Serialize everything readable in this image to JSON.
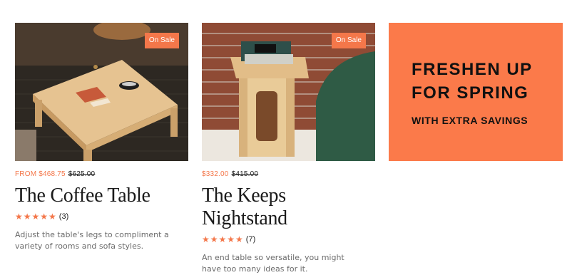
{
  "products": [
    {
      "badge": "On Sale",
      "price_sale": "FROM $468.75",
      "price_original": "$625.00",
      "title": "The Coffee Table",
      "stars": "★★★★★",
      "review_count": "(3)",
      "description": "Adjust the table's legs to compliment a variety of rooms and sofa styles."
    },
    {
      "badge": "On Sale",
      "price_sale": "$332.00",
      "price_original": "$415.00",
      "title": "The Keeps Nightstand",
      "stars": "★★★★★",
      "review_count": "(7)",
      "description": "An end table so versatile, you might have too many ideas for it."
    }
  ],
  "promo": {
    "line1": "FRESHEN UP",
    "line2": "FOR SPRING",
    "line3": "WITH EXTRA SAVINGS"
  },
  "colors": {
    "accent": "#f4774a",
    "promo_bg": "#fb7a4a"
  },
  "rating": {
    "coffee_table": 5,
    "nightstand": 5
  }
}
